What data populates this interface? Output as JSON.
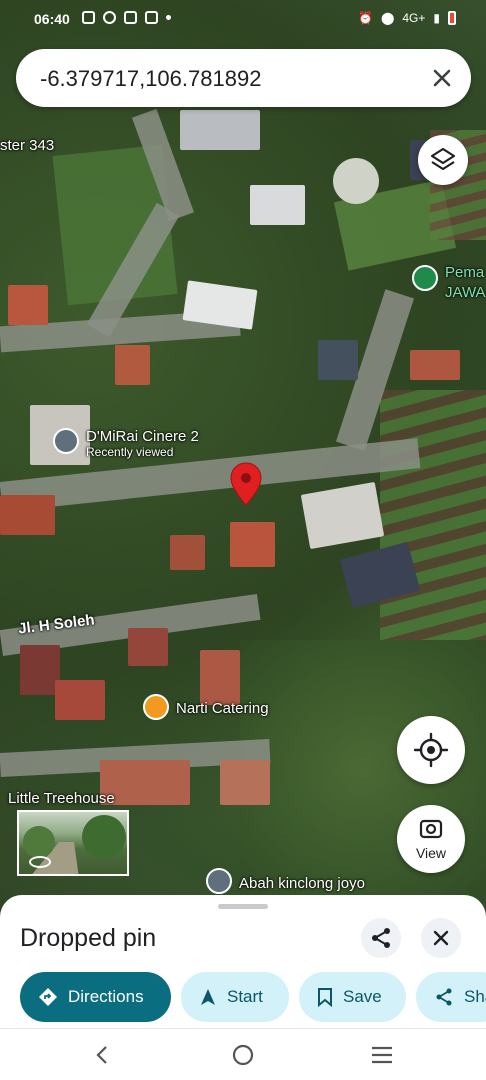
{
  "status_bar": {
    "time": "06:40",
    "network": "4G+"
  },
  "search": {
    "query": "-6.379717,106.781892"
  },
  "map": {
    "labels": {
      "ster": "ster 343",
      "pema": "Pema",
      "jawa": "JAWA",
      "dmirai": "D'MiRai Cinere 2",
      "dmirai_sub": "Recently viewed",
      "street": "Jl. H Soleh",
      "narti": "Narti Catering",
      "treehouse": "Little Treehouse",
      "abah": "Abah kinclong joyo"
    },
    "view_button": "View"
  },
  "sheet": {
    "title": "Dropped pin",
    "actions": {
      "directions": "Directions",
      "start": "Start",
      "save": "Save",
      "share": "Sha"
    }
  },
  "colors": {
    "primary_chip": "#0b6e80",
    "secondary_chip": "#d3f1f8",
    "pin": "#e02020",
    "poi_orange": "#f29a1f",
    "poi_green": "#1e8a4c"
  }
}
